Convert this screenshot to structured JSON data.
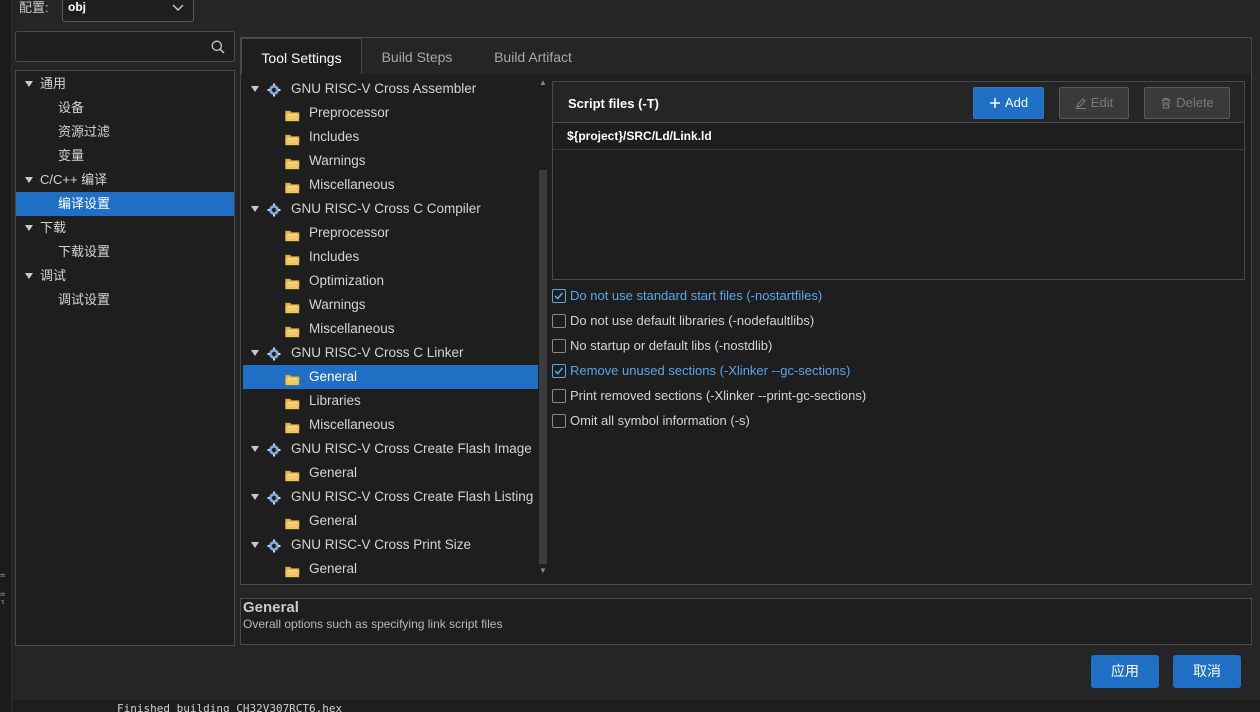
{
  "config": {
    "label": "配置:",
    "value": "obj"
  },
  "search": {
    "value": "",
    "placeholder": ""
  },
  "left_tree": {
    "items": [
      {
        "label": "通用",
        "level": 0,
        "expanded": true
      },
      {
        "label": "设备",
        "level": 1
      },
      {
        "label": "资源过滤",
        "level": 1
      },
      {
        "label": "变量",
        "level": 1
      },
      {
        "label": "C/C++ 编译",
        "level": 0,
        "expanded": true
      },
      {
        "label": "编译设置",
        "level": 1,
        "selected": true
      },
      {
        "label": "下载",
        "level": 0,
        "expanded": true
      },
      {
        "label": "下载设置",
        "level": 1
      },
      {
        "label": "调试",
        "level": 0,
        "expanded": true
      },
      {
        "label": "调试设置",
        "level": 1
      }
    ]
  },
  "tabs": [
    {
      "label": "Tool Settings",
      "active": true
    },
    {
      "label": "Build Steps",
      "active": false
    },
    {
      "label": "Build Artifact",
      "active": false
    }
  ],
  "tool_tree": [
    {
      "label": "GNU RISC-V Cross Assembler",
      "type": "tool"
    },
    {
      "label": "Preprocessor",
      "type": "page"
    },
    {
      "label": "Includes",
      "type": "page"
    },
    {
      "label": "Warnings",
      "type": "page"
    },
    {
      "label": "Miscellaneous",
      "type": "page"
    },
    {
      "label": "GNU RISC-V Cross C Compiler",
      "type": "tool"
    },
    {
      "label": "Preprocessor",
      "type": "page"
    },
    {
      "label": "Includes",
      "type": "page"
    },
    {
      "label": "Optimization",
      "type": "page"
    },
    {
      "label": "Warnings",
      "type": "page"
    },
    {
      "label": "Miscellaneous",
      "type": "page"
    },
    {
      "label": "GNU RISC-V Cross C Linker",
      "type": "tool"
    },
    {
      "label": "General",
      "type": "page",
      "selected": true
    },
    {
      "label": "Libraries",
      "type": "page"
    },
    {
      "label": "Miscellaneous",
      "type": "page"
    },
    {
      "label": "GNU RISC-V Cross Create Flash Image",
      "type": "tool"
    },
    {
      "label": "General",
      "type": "page"
    },
    {
      "label": "GNU RISC-V Cross Create Flash Listing",
      "type": "tool"
    },
    {
      "label": "General",
      "type": "page"
    },
    {
      "label": "GNU RISC-V Cross Print Size",
      "type": "tool"
    },
    {
      "label": "General",
      "type": "page"
    }
  ],
  "script_files": {
    "title": "Script files (-T)",
    "add_label": "Add",
    "edit_label": "Edit",
    "delete_label": "Delete",
    "entries": [
      "${project}/SRC/Ld/Link.ld"
    ]
  },
  "options": [
    {
      "label": "Do not use standard start files (-nostartfiles)",
      "checked": true
    },
    {
      "label": "Do not use default libraries (-nodefaultlibs)",
      "checked": false
    },
    {
      "label": "No startup or default libs (-nostdlib)",
      "checked": false
    },
    {
      "label": "Remove unused sections (-Xlinker --gc-sections)",
      "checked": true
    },
    {
      "label": "Print removed sections (-Xlinker --print-gc-sections)",
      "checked": false
    },
    {
      "label": "Omit all symbol information (-s)",
      "checked": false
    }
  ],
  "description": {
    "title": "General",
    "text": "Overall options such as specifying link script files"
  },
  "footer": {
    "apply_label": "应用",
    "cancel_label": "取消"
  },
  "console": {
    "line": "Finished building CH32V307RCT6.hex"
  },
  "edge_marks": [
    "=",
    "= ]"
  ],
  "colors": {
    "accent": "#1f6fc5",
    "checked_text": "#5aa6e8",
    "background": "#1e1e1e",
    "panel": "#252526",
    "border": "#4a4a4a"
  },
  "icons": {
    "search": "search-icon",
    "tool": "gear-icon",
    "page": "folder-icon",
    "add": "plus-icon",
    "edit": "pencil-icon",
    "delete": "trash-icon"
  }
}
